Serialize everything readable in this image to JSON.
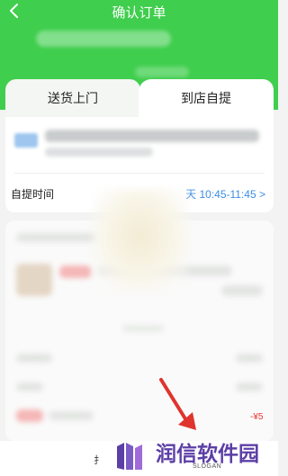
{
  "header": {
    "title": "确认订单"
  },
  "tabs": [
    {
      "label": "送货上门",
      "selected": false
    },
    {
      "label": "到店自提",
      "selected": true
    }
  ],
  "pickup": {
    "label": "自提时间",
    "value": "天 10:45-11:45 >"
  },
  "bottom": {
    "partial_text": "扌",
    "price_tag": "-¥5"
  },
  "watermark": {
    "brand": "润信软件园",
    "slogan": "SLOGAN"
  },
  "colors": {
    "header_green": "#3fce4d",
    "accent_blue": "#3b8de6",
    "arrow_red": "#e0342f",
    "brand_purple": "#5c3fa6"
  }
}
